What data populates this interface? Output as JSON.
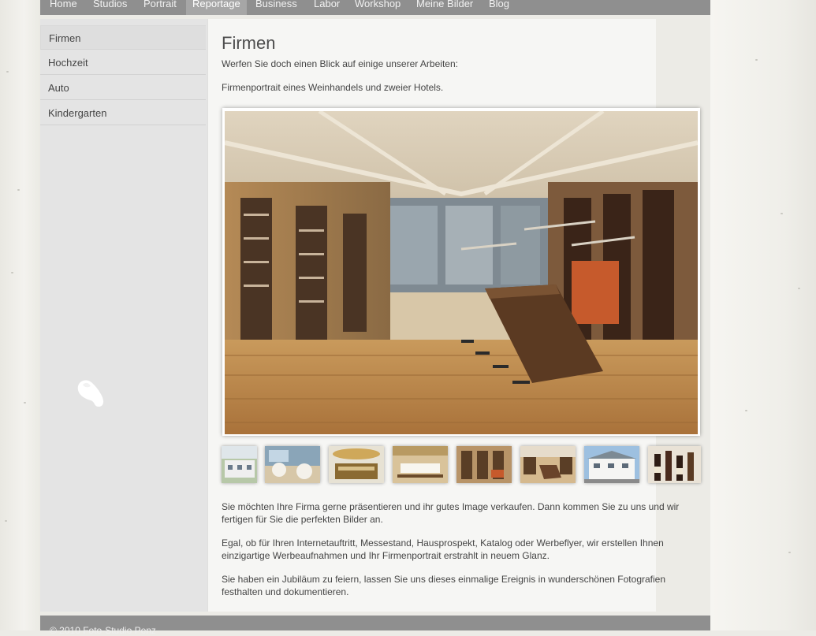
{
  "nav": {
    "items": [
      "Home",
      "Studios",
      "Portrait",
      "Reportage",
      "Business",
      "Labor",
      "Workshop",
      "Meine Bilder",
      "Blog"
    ],
    "active": "Reportage"
  },
  "sidebar": {
    "items": [
      "Firmen",
      "Hochzeit",
      "Auto",
      "Kindergarten"
    ],
    "active": "Firmen"
  },
  "main": {
    "title": "Firmen",
    "intro": "Werfen Sie doch einen Blick auf einige unserer Arbeiten:",
    "caption": "Firmenportrait eines Weinhandels und zweier Hotels.",
    "paragraphs": [
      "Sie möchten Ihre Firma gerne präsentieren und ihr gutes Image verkaufen. Dann kommen Sie zu uns und wir fertigen für Sie die perfekten Bilder an.",
      "Egal, ob für Ihren Internetauftritt, Messestand, Hausprospekt, Katalog oder Werbeflyer, wir erstellen Ihnen einzigartige Werbeaufnahmen und Ihr Firmenportrait erstrahlt in neuem Glanz.",
      "Sie haben ein Jubiläum zu feiern, lassen Sie uns dieses einmalige Ereignis in wunderschönen Fotografien festhalten und dokumentieren."
    ]
  },
  "gallery": {
    "main_image": "wine-shop-interior-photo",
    "thumbnails": [
      "hotel-exterior-thumb",
      "restaurant-dining-thumb",
      "hotel-bar-thumb",
      "banquet-room-thumb",
      "wine-shelves-thumb",
      "wine-shop-counter-thumb",
      "hotel-building-thumb",
      "wine-bottles-thumb"
    ]
  },
  "footer": {
    "copyright": "© 2010 Foto-Studio Penz"
  },
  "colors": {
    "nav_bg": "#8f8f8f",
    "nav_active": "#a6a6a6",
    "sidebar_bg": "#e4e4e4",
    "content_bg": "#f6f6f4",
    "text": "#444444"
  }
}
